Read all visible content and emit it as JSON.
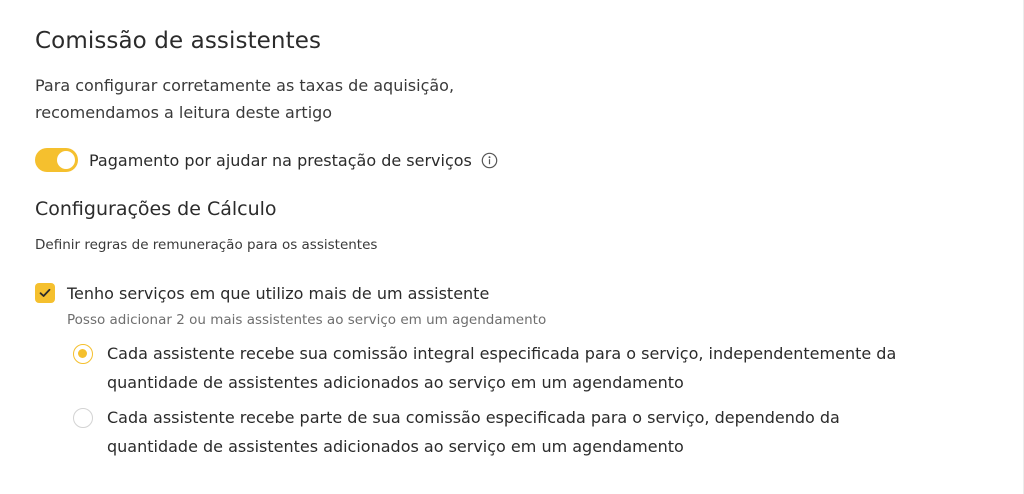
{
  "header": {
    "title": "Comissão de assistentes",
    "intro_line1": "Para configurar corretamente as taxas de aquisição,",
    "intro_line2": "recomendamos a leitura deste artigo"
  },
  "toggle": {
    "label": "Pagamento por ajudar na prestação de serviços",
    "enabled": true,
    "info_icon": "info-icon"
  },
  "calculation": {
    "title": "Configurações de Cálculo",
    "description": "Definir regras de remuneração para os assistentes",
    "multi_assistant": {
      "label": "Tenho serviços em que utilizo mais de um assistente",
      "checked": true,
      "hint": "Posso adicionar 2 ou mais assistentes ao serviço em um agendamento"
    },
    "options": [
      {
        "line1": "Cada assistente recebe sua comissão integral especificada para o serviço, independentemente da",
        "line2": "quantidade de assistentes adicionados ao serviço em um agendamento",
        "selected": true
      },
      {
        "line1": "Cada assistente recebe parte de sua comissão especificada para o serviço, dependendo da",
        "line2": "quantidade de assistentes adicionados ao serviço em um agendamento",
        "selected": false
      }
    ]
  },
  "colors": {
    "accent": "#f5c02e",
    "text": "#2b2b2b",
    "muted": "#6e6e6e"
  }
}
